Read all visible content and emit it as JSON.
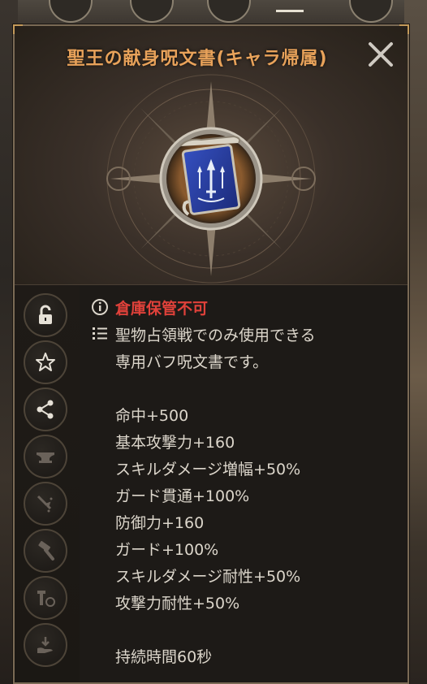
{
  "item": {
    "title": "聖王の献身呪文書(キャラ帰属)",
    "icon": "blue-scroll-sword-icon"
  },
  "header": {
    "close_icon": "close-x-icon"
  },
  "sidebar": {
    "buttons": [
      {
        "icon": "unlock-icon"
      },
      {
        "icon": "star-icon"
      },
      {
        "icon": "share-icon"
      },
      {
        "icon": "anvil-icon"
      },
      {
        "icon": "sparkle-quill-icon"
      },
      {
        "icon": "hammer-icon"
      },
      {
        "icon": "craft-tools-icon"
      },
      {
        "icon": "hand-download-icon"
      }
    ]
  },
  "info": {
    "warning": "倉庫保管不可",
    "description": [
      "聖物占領戦でのみ使用できる",
      "専用バフ呪文書です。"
    ],
    "stats": [
      "命中+500",
      "基本攻撃力+160",
      "スキルダメージ増幅+50%",
      "ガード貫通+100%",
      "防御力+160",
      "ガード+100%",
      "スキルダメージ耐性+50%",
      "攻撃力耐性+50%"
    ],
    "duration": "持続時間60秒"
  },
  "colors": {
    "title": "#e8a25a",
    "warning": "#e0413a",
    "text": "#dcd6cb",
    "scroll_blue": "#2a3f9e"
  }
}
